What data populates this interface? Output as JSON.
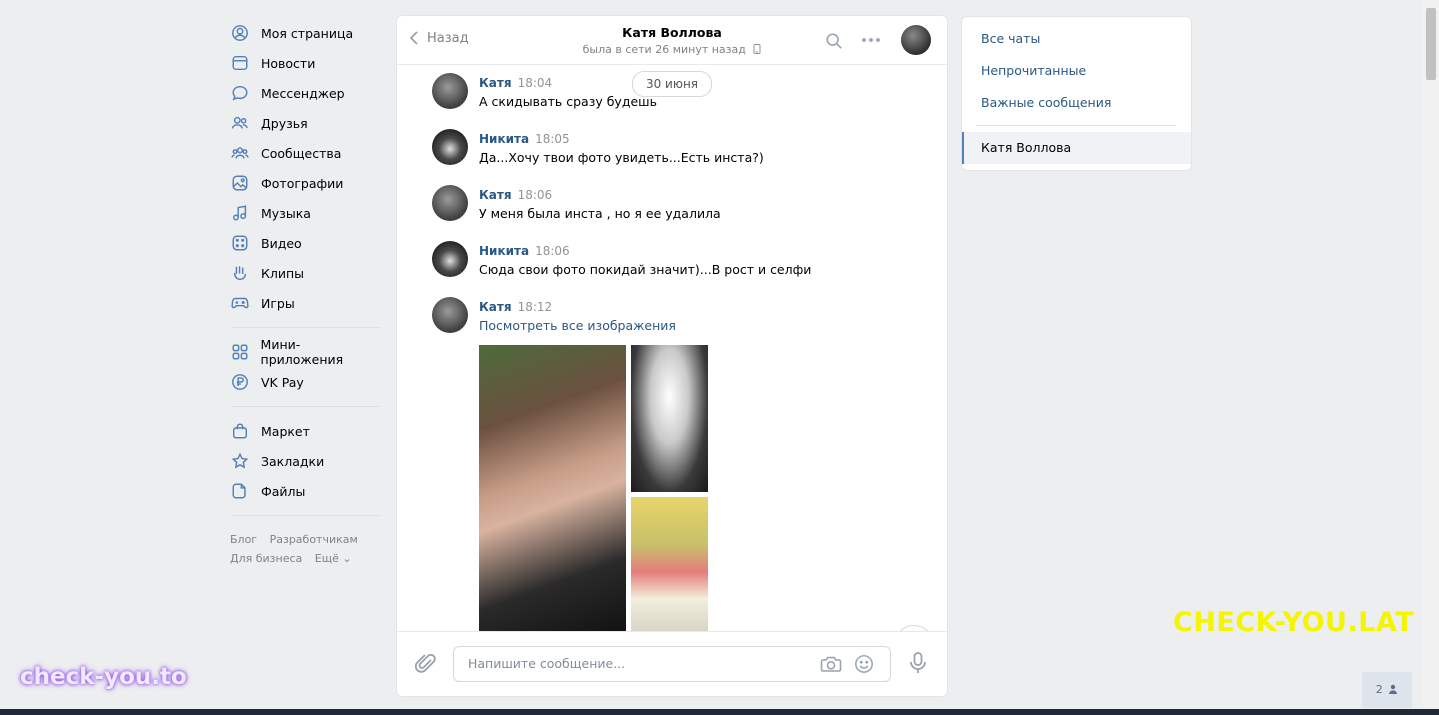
{
  "sidebar": {
    "items": [
      {
        "label": "Моя страница",
        "icon": "user-circle-icon"
      },
      {
        "label": "Новости",
        "icon": "news-icon"
      },
      {
        "label": "Мессенджер",
        "icon": "chat-bubble-icon"
      },
      {
        "label": "Друзья",
        "icon": "friends-icon"
      },
      {
        "label": "Сообщества",
        "icon": "communities-icon"
      },
      {
        "label": "Фотографии",
        "icon": "photo-icon"
      },
      {
        "label": "Музыка",
        "icon": "music-note-icon"
      },
      {
        "label": "Видео",
        "icon": "video-icon"
      },
      {
        "label": "Клипы",
        "icon": "clips-icon"
      },
      {
        "label": "Игры",
        "icon": "gamepad-icon"
      }
    ],
    "items2": [
      {
        "label": "Мини-приложения",
        "icon": "grid-icon"
      },
      {
        "label": "VK Pay",
        "icon": "ruble-icon"
      }
    ],
    "items3": [
      {
        "label": "Маркет",
        "icon": "bag-icon"
      },
      {
        "label": "Закладки",
        "icon": "star-icon"
      },
      {
        "label": "Файлы",
        "icon": "file-icon"
      }
    ],
    "footer": {
      "blog": "Блог",
      "developers": "Разработчикам",
      "business": "Для бизнеса",
      "more": "Ещё ⌄"
    }
  },
  "chat": {
    "back_label": "Назад",
    "peer_name": "Катя Воллова",
    "peer_status": "была в сети 26 минут назад",
    "date_pill": "30 июня",
    "messages": [
      {
        "author": "Катя",
        "time": "18:04",
        "text": "А скидывать сразу будешь"
      },
      {
        "author": "Никита",
        "time": "18:05",
        "text": "Да...Хочу твои фото увидеть...Есть инста?)"
      },
      {
        "author": "Катя",
        "time": "18:06",
        "text": "У меня была инста , но я ее удалила"
      },
      {
        "author": "Никита",
        "time": "18:06",
        "text": "Сюда свои фото покидай значит)...В рост и селфи"
      },
      {
        "author": "Катя",
        "time": "18:12",
        "text": "Посмотреть все изображения"
      }
    ],
    "composer_placeholder": "Напишите сообщение..."
  },
  "right_panel": {
    "all_chats": "Все чаты",
    "unread": "Непрочитанные",
    "important": "Важные сообщения",
    "active_chat": "Катя Воллова"
  },
  "watermarks": {
    "yellow": "CHECK-YOU.LAT",
    "purple": "check-you.to"
  },
  "online_count": "2",
  "colors": {
    "link": "#2a5885",
    "accent": "#5181b8",
    "background": "#edeef0"
  }
}
